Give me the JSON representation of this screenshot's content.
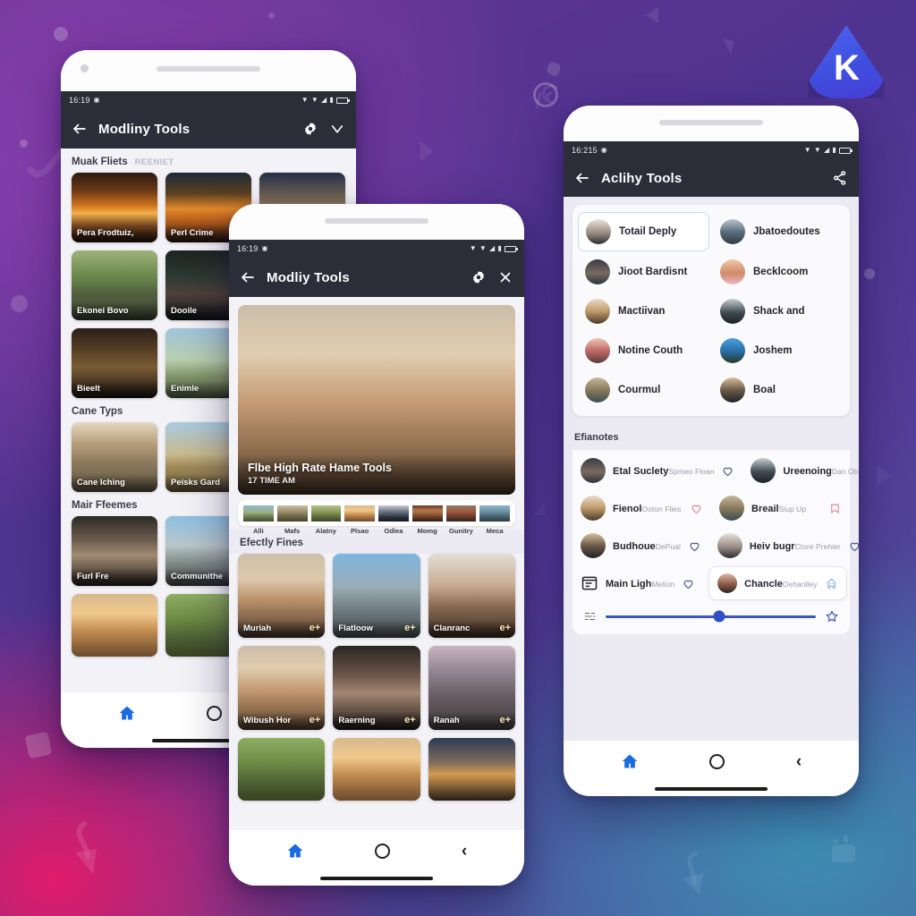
{
  "brand": {
    "logo_letter": "K",
    "logo_color": "#4a56e8"
  },
  "background": {
    "colors": [
      "#6a3694",
      "#4e3390",
      "#e01b6a",
      "#3d8fb4"
    ]
  },
  "phone_left": {
    "status_bar": {
      "time": "16:19",
      "icons": [
        "wifi-icon",
        "signal-icon",
        "vibrate-icon",
        "battery-icon"
      ]
    },
    "appbar": {
      "title": "Modliny Tools",
      "back": "back-arrow-icon",
      "action1": "settings-gear-icon",
      "action2": "chevron-down-icon"
    },
    "sections": [
      {
        "title": "Muak Fliets",
        "subtitle": "REENIET",
        "tiles": [
          {
            "caption": "Pera Frodtuiz,",
            "photo": "ph-sunset"
          },
          {
            "caption": "Perl Crime",
            "photo": "ph-sunset2"
          },
          {
            "caption": "",
            "photo": "ph-dusk"
          },
          {
            "caption": "Ekonei Bovo",
            "photo": "ph-street"
          },
          {
            "caption": "Dooile",
            "photo": "ph-portdark"
          },
          {
            "caption": "",
            "photo": "ph-cafe"
          },
          {
            "caption": "Bieelt",
            "photo": "ph-cafe"
          },
          {
            "caption": "Enimle",
            "photo": "ph-tower"
          },
          {
            "caption": "",
            "photo": "ph-street"
          }
        ]
      },
      {
        "title": "Cane Typs",
        "subtitle": "",
        "tiles": [
          {
            "caption": "Cane Iching",
            "photo": "ph-hill"
          },
          {
            "caption": "Peisks Gard",
            "photo": "ph-barn"
          },
          {
            "caption": "",
            "photo": "ph-lake"
          }
        ]
      },
      {
        "title": "Mair Ffeemes",
        "subtitle": "",
        "tiles": [
          {
            "caption": "Furl Fre",
            "photo": "ph-man"
          },
          {
            "caption": "Communithe",
            "photo": "ph-city"
          },
          {
            "caption": "",
            "photo": "ph-build"
          }
        ]
      },
      {
        "title": "",
        "subtitle": "",
        "tiles": [
          {
            "caption": "",
            "photo": "ph-beach"
          },
          {
            "caption": "",
            "photo": "ph-green"
          },
          {
            "caption": "",
            "photo": "ph-road"
          }
        ]
      }
    ],
    "navbar": {
      "home": "home-icon",
      "recents": "circle-icon",
      "back": "back-chevron-icon"
    }
  },
  "phone_mid": {
    "status_bar": {
      "time": "16:19"
    },
    "appbar": {
      "title": "Modliy Tools",
      "back": "back-arrow-icon",
      "action1": "settings-gear-icon",
      "action2": "close-x-icon"
    },
    "hero": {
      "photo": "ph-blonde",
      "title": "Flbe High Rate Hame Tools",
      "subtitle": "17 TIME AM"
    },
    "filter_chips": [
      {
        "label": "Alli",
        "photo": "ph-road"
      },
      {
        "label": "Mafs",
        "photo": "ph-trail"
      },
      {
        "label": "Alatny",
        "photo": "ph-vine"
      },
      {
        "label": "Plsao",
        "photo": "ph-beach"
      },
      {
        "label": "Odlea",
        "photo": "ph-head"
      },
      {
        "label": "Momg",
        "photo": "ph-woman2"
      },
      {
        "label": "Gunitry",
        "photo": "ph-brick"
      },
      {
        "label": "Meca",
        "photo": "ph-sea"
      }
    ],
    "grid_section": {
      "title": "Efectly Fines"
    },
    "grid_tiles": [
      {
        "caption": "Muriah",
        "badge": "e+",
        "photo": "ph-blonde2"
      },
      {
        "caption": "Flatloow",
        "badge": "e+",
        "photo": "ph-build"
      },
      {
        "caption": "Clanranc",
        "badge": "e+",
        "photo": "ph-vest"
      },
      {
        "caption": "Wibush Hor",
        "badge": "e+",
        "photo": "ph-blonde"
      },
      {
        "caption": "Raerning",
        "badge": "e+",
        "photo": "ph-wom"
      },
      {
        "caption": "Ranah",
        "badge": "e+",
        "photo": "ph-mount"
      },
      {
        "caption": "",
        "badge": "",
        "photo": "ph-green"
      },
      {
        "caption": "",
        "badge": "",
        "photo": "ph-beach"
      },
      {
        "caption": "",
        "badge": "",
        "photo": "ph-lake"
      }
    ],
    "navbar": {
      "home": "home-icon",
      "recents": "circle-icon",
      "back": "back-chevron-icon"
    }
  },
  "phone_right": {
    "status_bar": {
      "time": "16:215"
    },
    "appbar": {
      "title": "Aclihy Tools",
      "back": "back-arrow-icon",
      "action1": "share-icon"
    },
    "people": [
      {
        "name": "Totail Deply",
        "avatar": "av1",
        "selected": true
      },
      {
        "name": "Jbatoedoutes",
        "avatar": "av2",
        "selected": false
      },
      {
        "name": "Jioot Bardisnt",
        "avatar": "av3",
        "selected": false
      },
      {
        "name": "Becklcoom",
        "avatar": "av4",
        "selected": false
      },
      {
        "name": "Mactiivan",
        "avatar": "av5",
        "selected": false
      },
      {
        "name": "Shack and",
        "avatar": "av6",
        "selected": false
      },
      {
        "name": "Notine Couth",
        "avatar": "av7",
        "selected": false
      },
      {
        "name": "Joshem",
        "avatar": "av8",
        "selected": false
      },
      {
        "name": "Courmul",
        "avatar": "av9",
        "selected": false
      },
      {
        "name": "Boal",
        "avatar": "av10",
        "selected": false
      }
    ],
    "list_section": {
      "title": "Efianotes"
    },
    "list_rows": [
      {
        "name": "Etal Suclety",
        "sub": "Spmeo Floan",
        "avatar": "av3",
        "icon": "heart-icon",
        "icon_style": ""
      },
      {
        "name": "Ureenoing",
        "sub": "Dan Otoore",
        "avatar": "av6",
        "icon": "heart-icon",
        "icon_style": ""
      },
      {
        "name": "Fienol",
        "sub": "Ooton Flies",
        "avatar": "av5",
        "icon": "heart-icon",
        "icon_style": "pink"
      },
      {
        "name": "Breail",
        "sub": "Siup Up",
        "avatar": "av9",
        "icon": "bookmark-icon",
        "icon_style": "outline-sq"
      },
      {
        "name": "Budhoue",
        "sub": "DePual",
        "avatar": "av10",
        "icon": "heart-icon",
        "icon_style": ""
      },
      {
        "name": "Heiv bugr",
        "sub": "Ctore Prehier",
        "avatar": "av1",
        "icon": "heart-icon",
        "icon_style": ""
      }
    ],
    "bottom_rows": [
      {
        "name": "Main Ligh",
        "sub": "Metion",
        "icon_left": "window-icon",
        "icon_right": "heart-icon",
        "boxed": false
      },
      {
        "name": "Chancle",
        "sub": "Oehanlley",
        "icon_left": "dog-icon",
        "icon_right": "building-icon",
        "boxed": true
      }
    ],
    "slider": {
      "value_percent": 54,
      "left_icon": "equalizer-icon",
      "right_icon": "star-icon"
    },
    "navbar": {
      "home": "home-icon",
      "recents": "circle-icon",
      "back": "back-chevron-icon"
    }
  }
}
